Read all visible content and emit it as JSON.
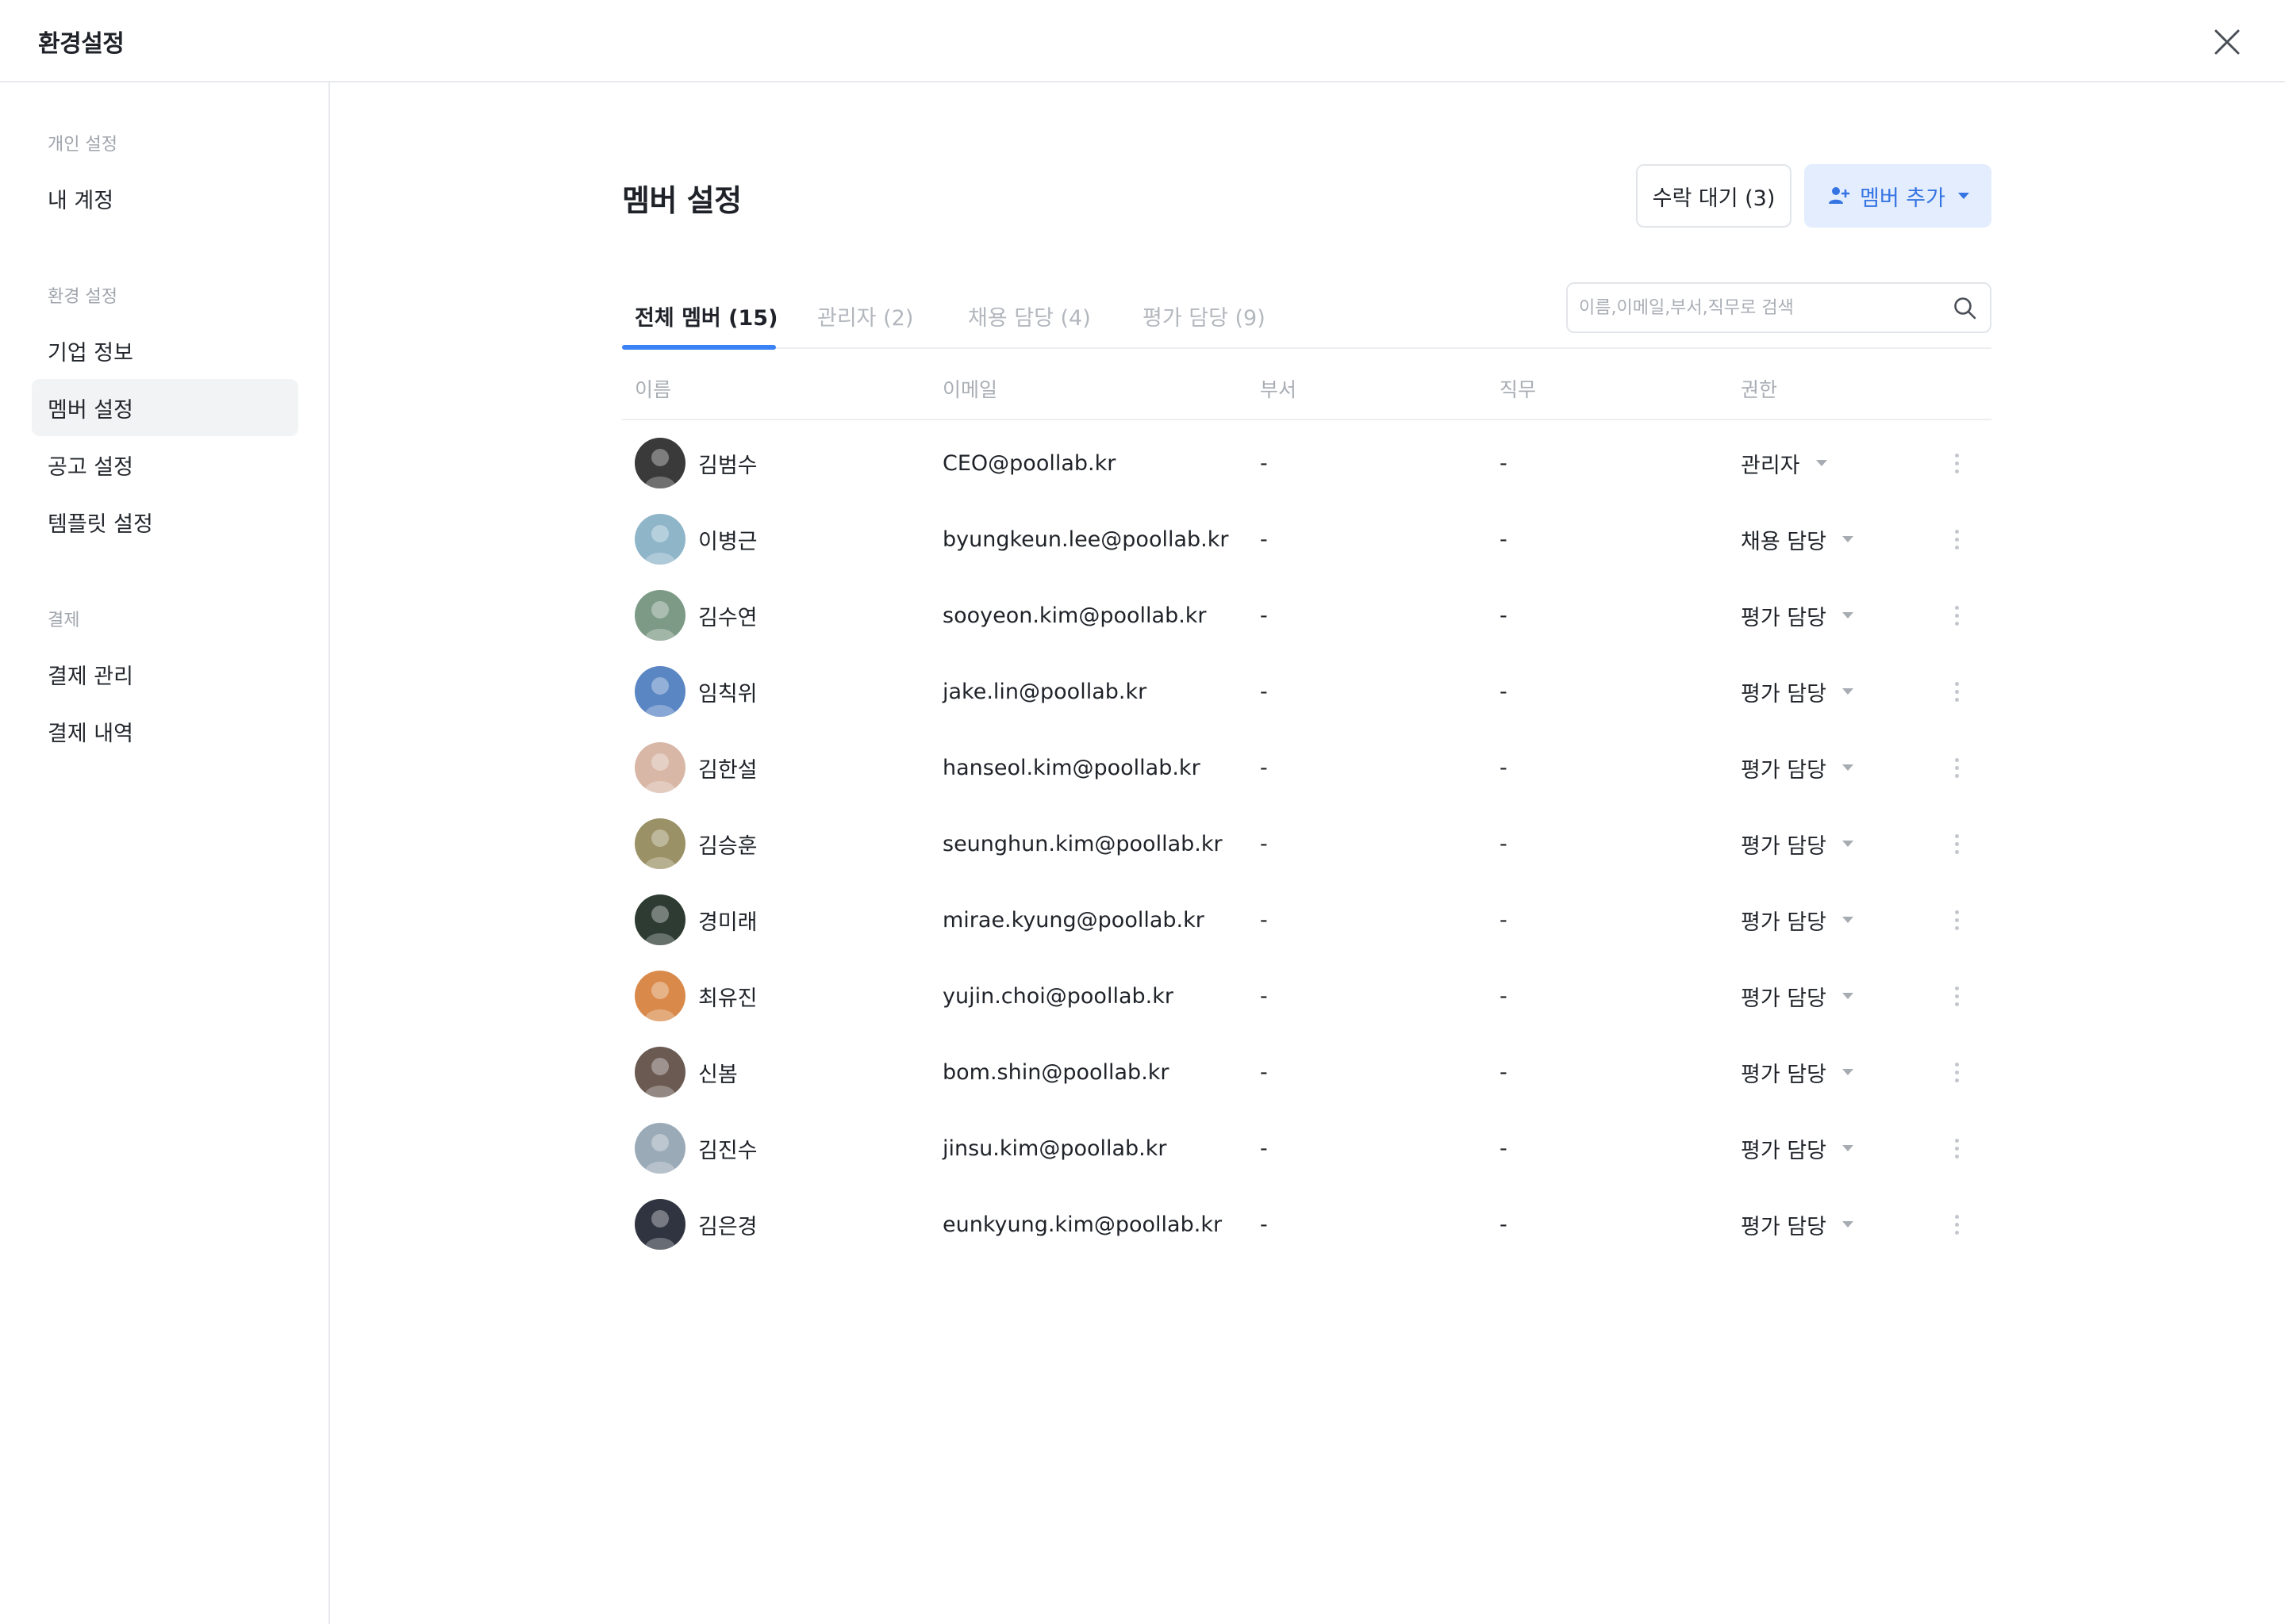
{
  "window": {
    "title": "환경설정"
  },
  "sidebar": {
    "groups": [
      {
        "label": "개인 설정",
        "items": [
          {
            "label": "내 계정"
          }
        ]
      },
      {
        "label": "환경 설정",
        "items": [
          {
            "label": "기업 정보"
          },
          {
            "label": "멤버 설정",
            "active": true
          },
          {
            "label": "공고 설정"
          },
          {
            "label": "템플릿 설정"
          }
        ]
      },
      {
        "label": "결제",
        "items": [
          {
            "label": "결제 관리"
          },
          {
            "label": "결제 내역"
          }
        ]
      }
    ]
  },
  "main": {
    "title": "멤버 설정",
    "pending_button": "수락 대기 (3)",
    "add_button": "멤버 추가",
    "tabs": [
      {
        "label": "전체 멤버 (15)",
        "active": true
      },
      {
        "label": "관리자 (2)"
      },
      {
        "label": "채용 담당 (4)"
      },
      {
        "label": "평가 담당 (9)"
      }
    ],
    "search": {
      "placeholder": "이름,이메일,부서,직무로 검색",
      "value": ""
    },
    "columns": [
      "이름",
      "이메일",
      "부서",
      "직무",
      "권한"
    ],
    "rows": [
      {
        "name": "김범수",
        "email": "CEO@poollab.kr",
        "dept": "-",
        "job": "-",
        "role": "관리자",
        "avatar_color": "#3a3a3a"
      },
      {
        "name": "이병근",
        "email": "byungkeun.lee@poollab.kr",
        "dept": "-",
        "job": "-",
        "role": "채용 담당",
        "avatar_color": "#8fb5c9"
      },
      {
        "name": "김수연",
        "email": "sooyeon.kim@poollab.kr",
        "dept": "-",
        "job": "-",
        "role": "평가 담당",
        "avatar_color": "#7d9a86"
      },
      {
        "name": "임칙위",
        "email": "jake.lin@poollab.kr",
        "dept": "-",
        "job": "-",
        "role": "평가 담당",
        "avatar_color": "#5a86c4"
      },
      {
        "name": "김한설",
        "email": "hanseol.kim@poollab.kr",
        "dept": "-",
        "job": "-",
        "role": "평가 담당",
        "avatar_color": "#d8b7a7"
      },
      {
        "name": "김승훈",
        "email": "seunghun.kim@poollab.kr",
        "dept": "-",
        "job": "-",
        "role": "평가 담당",
        "avatar_color": "#9a9166"
      },
      {
        "name": "경미래",
        "email": "mirae.kyung@poollab.kr",
        "dept": "-",
        "job": "-",
        "role": "평가 담당",
        "avatar_color": "#2d3b33"
      },
      {
        "name": "최유진",
        "email": "yujin.choi@poollab.kr",
        "dept": "-",
        "job": "-",
        "role": "평가 담당",
        "avatar_color": "#d98a4a"
      },
      {
        "name": "신봄",
        "email": "bom.shin@poollab.kr",
        "dept": "-",
        "job": "-",
        "role": "평가 담당",
        "avatar_color": "#6b5a52"
      },
      {
        "name": "김진수",
        "email": "jinsu.kim@poollab.kr",
        "dept": "-",
        "job": "-",
        "role": "평가 담당",
        "avatar_color": "#9aaab7"
      },
      {
        "name": "김은경",
        "email": "eunkyung.kim@poollab.kr",
        "dept": "-",
        "job": "-",
        "role": "평가 담당",
        "avatar_color": "#2f3440"
      }
    ]
  },
  "colors": {
    "accent": "#3b82f6",
    "accent_bg": "#e3edfd",
    "active_bg": "#f2f3f5",
    "muted_text": "#a9aeb5"
  },
  "icons": {
    "close": "close-icon",
    "search": "search-icon",
    "add_user": "user-plus-icon",
    "caret": "chevron-down-icon",
    "more": "more-vertical-icon"
  }
}
